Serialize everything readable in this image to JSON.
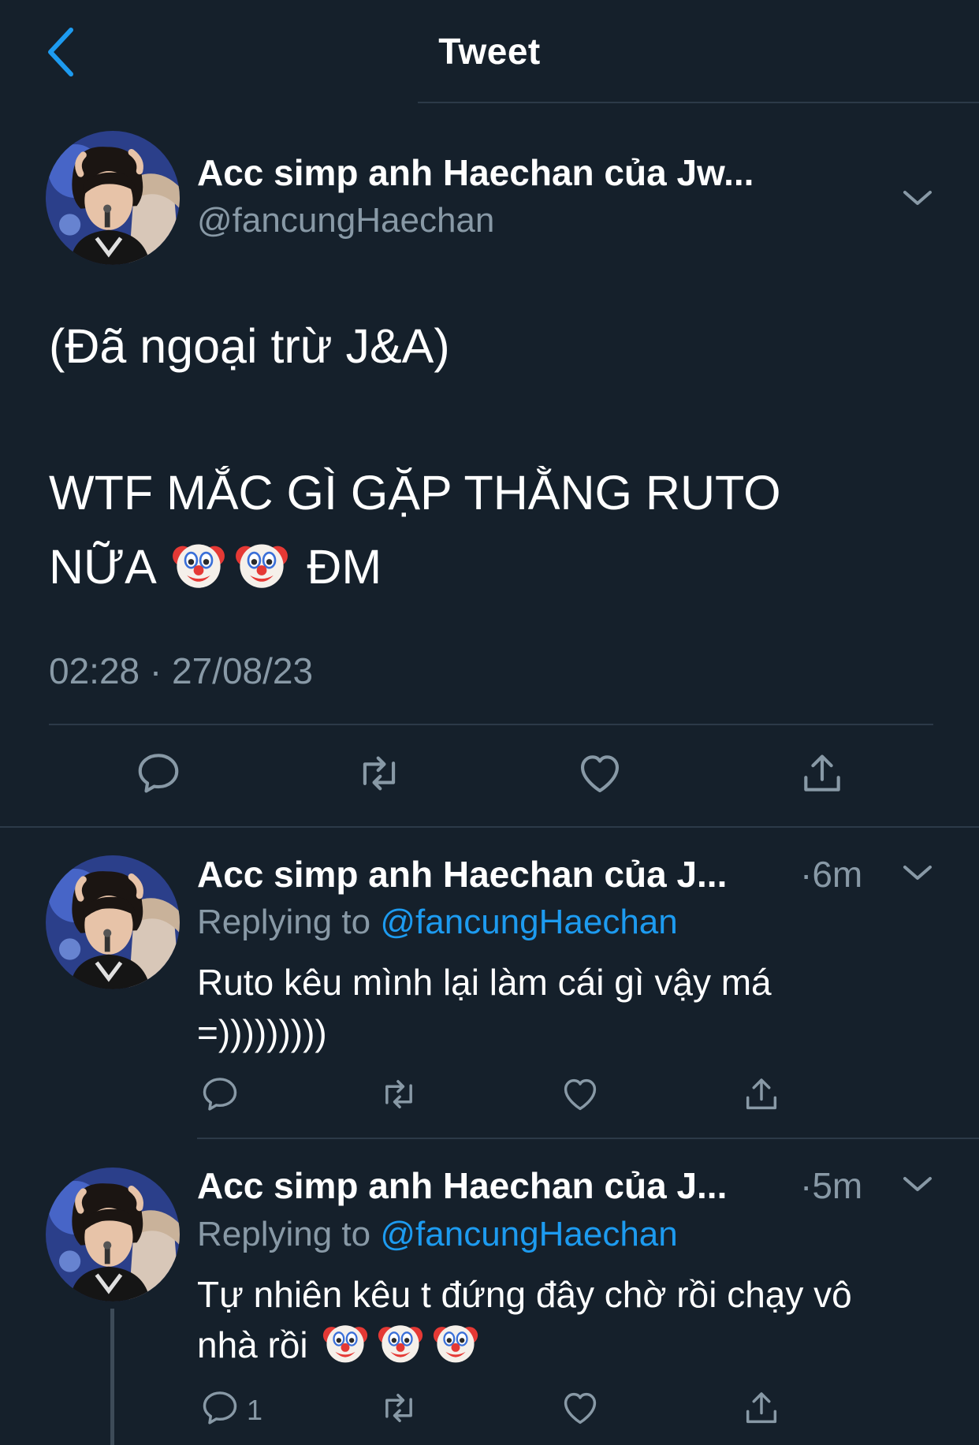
{
  "header": {
    "title": "Tweet"
  },
  "main_tweet": {
    "name": "Acc simp anh Haechan của Jw...",
    "handle": "@fancungHaechan",
    "text_line1": "(Đã ngoại trừ J&A)",
    "text_line2": "WTF MẮC GÌ GẶP THẰNG RUTO",
    "text_line3_prefix": "NỮA",
    "text_line3_suffix": "ĐM",
    "timestamp": "02:28 · 27/08/23"
  },
  "replies": [
    {
      "name": "Acc simp anh Haechan của J...",
      "time": "·6m",
      "replying_prefix": "Replying to",
      "replying_handle": "@fancungHaechan",
      "text_line1": "Ruto kêu mình lại làm cái gì vậy má",
      "text_line2": "=)))))))))",
      "reply_count": ""
    },
    {
      "name": "Acc simp anh Haechan của J...",
      "time": "·5m",
      "replying_prefix": "Replying to",
      "replying_handle": "@fancungHaechan",
      "text_line1": "Tự nhiên kêu t đứng đây chờ rồi chạy vô",
      "text_line2_prefix": "nhà rồi",
      "reply_count": "1"
    }
  ],
  "icons": {
    "back": "chevron-left-icon",
    "more": "chevron-down-icon",
    "reply": "reply-icon",
    "retweet": "retweet-icon",
    "like": "heart-icon",
    "share": "share-icon",
    "emoji": "clown-face-emoji"
  },
  "colors": {
    "background": "#15202b",
    "accent": "#1d9bf0",
    "secondary_text": "#8899a6",
    "divider": "#2c3a48"
  }
}
